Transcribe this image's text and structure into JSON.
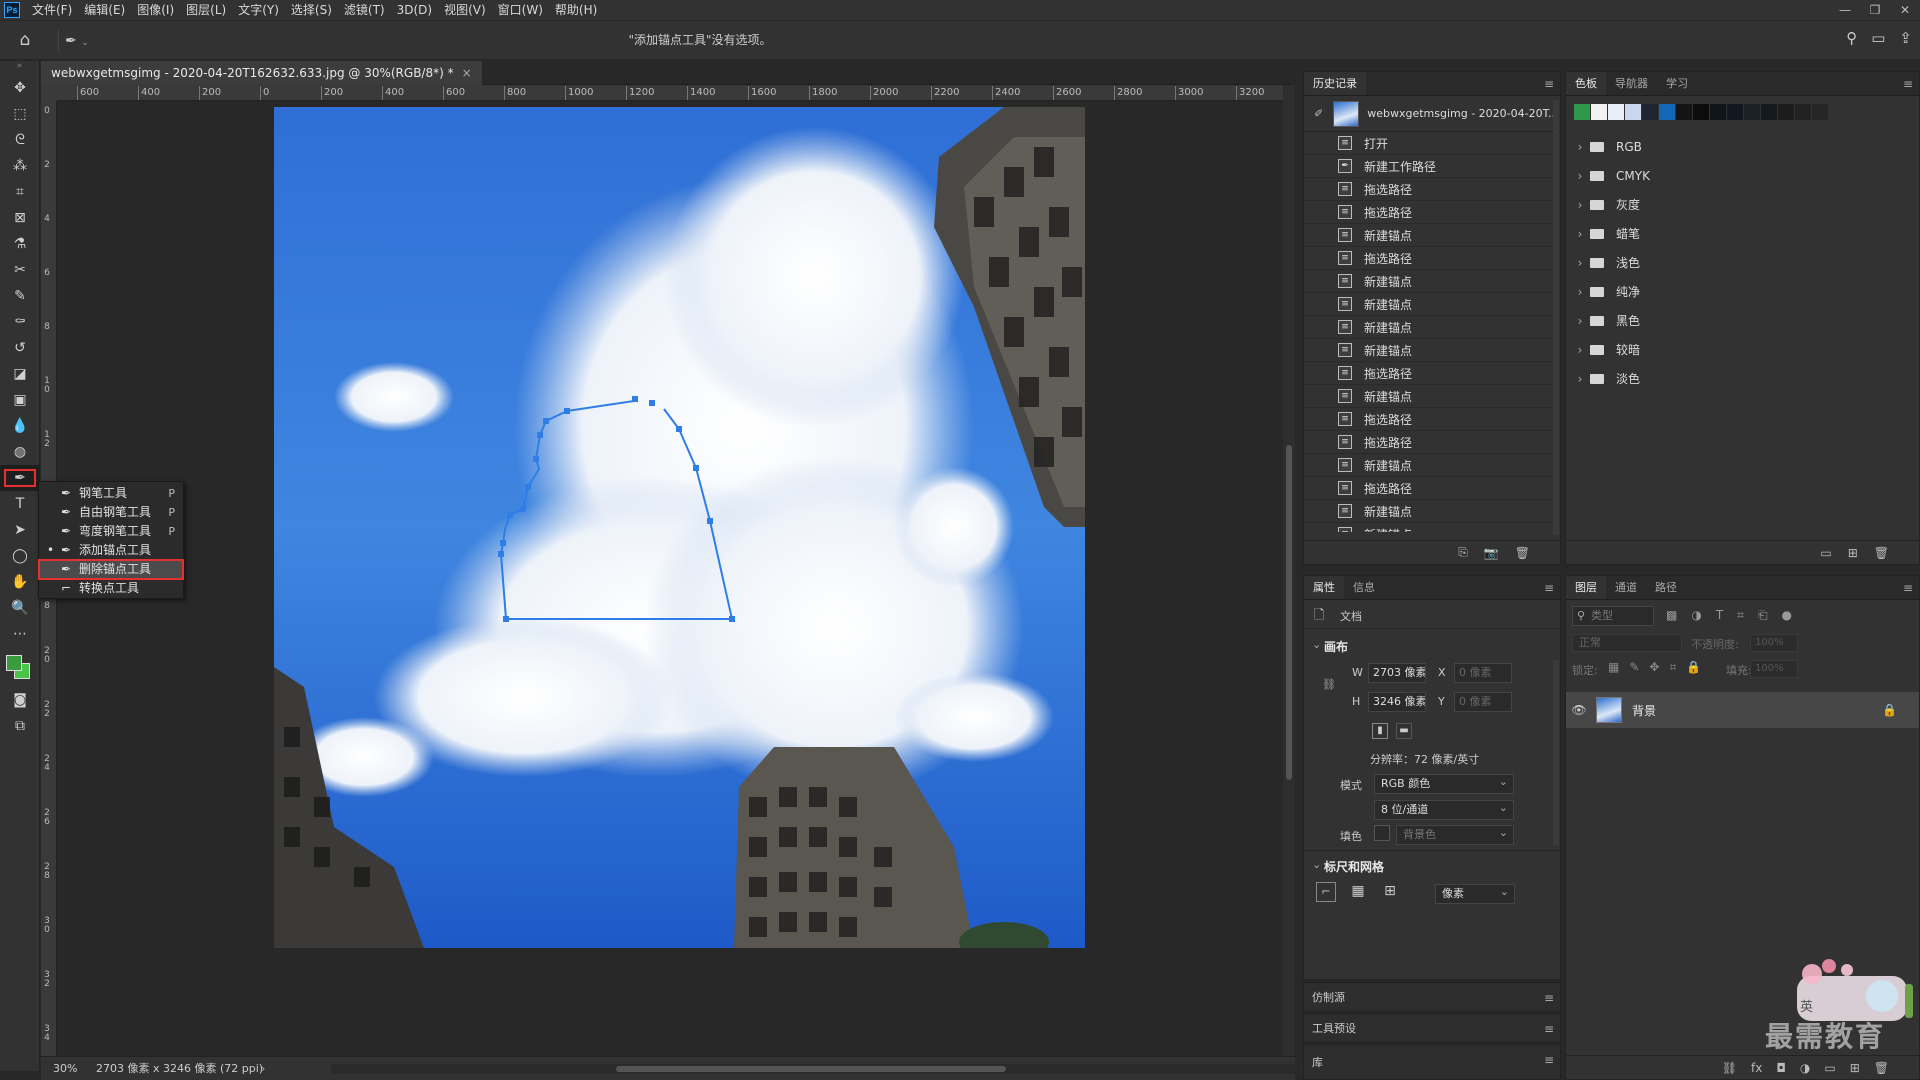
{
  "app": {
    "logo": "Ps"
  },
  "menu": [
    "文件(F)",
    "编辑(E)",
    "图像(I)",
    "图层(L)",
    "文字(Y)",
    "选择(S)",
    "滤镜(T)",
    "3D(D)",
    "视图(V)",
    "窗口(W)",
    "帮助(H)"
  ],
  "options_bar": {
    "message": "\"添加锚点工具\"没有选项。"
  },
  "document": {
    "tab_title": "webwxgetmsgimg - 2020-04-20T162632.633.jpg @ 30%(RGB/8*) *",
    "tab_close": "×",
    "ruler_h": [
      "600",
      "400",
      "200",
      "0",
      "200",
      "400",
      "600",
      "800",
      "1000",
      "1200",
      "1400",
      "1600",
      "1800",
      "2000",
      "2200",
      "2400",
      "2600",
      "2800",
      "3000",
      "3200"
    ],
    "ruler_v": [
      "0",
      "2",
      "4",
      "6",
      "8",
      "1 0",
      "1 2",
      "1 4",
      "1 6",
      "1 8",
      "2 0",
      "2 2",
      "2 4",
      "2 6",
      "2 8",
      "3 0",
      "3 2",
      "3 4"
    ]
  },
  "statusbar": {
    "zoom": "30%",
    "info": "2703 像素 x 3246 像素 (72 ppi)",
    "arrow": "›"
  },
  "flyout": [
    {
      "label": "钢笔工具",
      "key": "P",
      "icon": "pen-icon",
      "active": false
    },
    {
      "label": "自由钢笔工具",
      "key": "P",
      "icon": "freeform-pen-icon",
      "active": false
    },
    {
      "label": "弯度钢笔工具",
      "key": "P",
      "icon": "curvature-pen-icon",
      "active": false
    },
    {
      "label": "添加锚点工具",
      "key": "",
      "icon": "add-anchor-icon",
      "active": true
    },
    {
      "label": "删除锚点工具",
      "key": "",
      "icon": "delete-anchor-icon",
      "active": false,
      "highlighted": true
    },
    {
      "label": "转换点工具",
      "key": "",
      "icon": "convert-point-icon",
      "active": false
    }
  ],
  "history": {
    "tabs": [
      "历史记录"
    ],
    "snapshot": "webwxgetmsgimg - 2020-04-20T...",
    "items": [
      "打开",
      "新建工作路径",
      "拖选路径",
      "拖选路径",
      "新建锚点",
      "拖选路径",
      "新建锚点",
      "新建锚点",
      "新建锚点",
      "新建锚点",
      "拖选路径",
      "新建锚点",
      "拖选路径",
      "拖选路径",
      "新建锚点",
      "拖选路径",
      "新建锚点",
      "新建锚点"
    ]
  },
  "swatches": {
    "tabs": [
      "色板",
      "导航器",
      "学习"
    ],
    "colors": [
      "#2c9a4a",
      "#f2f2f2",
      "#e8eef8",
      "#c8d6ee",
      "#1e2430",
      "#1467b8",
      "#141414",
      "#0c0c0c",
      "#10151c",
      "#121820",
      "#1a2226",
      "#141a1e",
      "#1c1c1c",
      "#222222",
      "#262626"
    ],
    "folders": [
      "RGB",
      "CMYK",
      "灰度",
      "蜡笔",
      "浅色",
      "纯净",
      "黑色",
      "较暗",
      "淡色"
    ]
  },
  "properties": {
    "tabs": [
      "属性",
      "信息"
    ],
    "doc_label": "文档",
    "canvas_title": "画布",
    "w_label": "W",
    "w_value": "2703 像素",
    "h_label": "H",
    "h_value": "3246 像素",
    "x_label": "X",
    "x_value": "0 像素",
    "y_label": "Y",
    "y_value": "0 像素",
    "resolution": "分辨率：72 像素/英寸",
    "mode_label": "模式",
    "mode_value": "RGB 颜色",
    "depth_value": "8 位/通道",
    "fill_label": "填色",
    "fill_value": "背景色",
    "rulers_title": "标尺和网格",
    "unit_value": "像素"
  },
  "collapsed_panels": [
    "仿制源",
    "工具预设",
    "库"
  ],
  "layers": {
    "tabs": [
      "图层",
      "通道",
      "路径"
    ],
    "filter_placeholder": "类型",
    "blend_mode": "正常",
    "opacity_label": "不透明度:",
    "opacity_value": "100%",
    "lock_label": "锁定:",
    "fill_label": "填充:",
    "fill_value": "100%",
    "layer_name": "背景"
  },
  "watermark": {
    "text": "最需教育",
    "badge": "英"
  }
}
